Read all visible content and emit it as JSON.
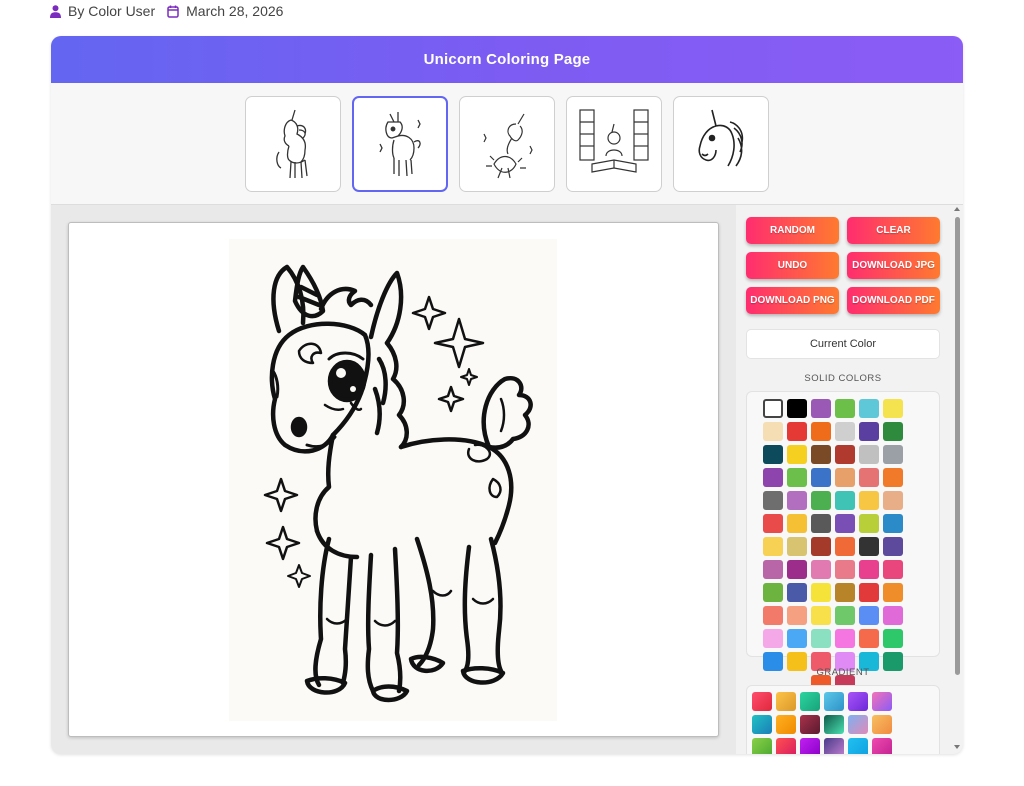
{
  "meta": {
    "author": "By Color User",
    "date": "March 28, 2026"
  },
  "header": {
    "title": "Unicorn Coloring Page"
  },
  "thumbnails": [
    {
      "name": "standing-unicorn",
      "active": false
    },
    {
      "name": "baby-unicorn",
      "active": true
    },
    {
      "name": "unicorn-with-flowers",
      "active": false
    },
    {
      "name": "unicorn-library",
      "active": false
    },
    {
      "name": "unicorn-head",
      "active": false
    }
  ],
  "buttons": {
    "random": "RANDOM",
    "clear": "CLEAR",
    "undo": "UNDO",
    "download_jpg": "DOWNLOAD JPG",
    "download_png": "DOWNLOAD PNG",
    "download_pdf": "DOWNLOAD PDF"
  },
  "current_color": {
    "label": "Current Color"
  },
  "solid": {
    "title": "SOLID COLORS",
    "colors": [
      "#ffffff",
      "#000000",
      "#9b59b6",
      "#6cc04a",
      "#5fc8d8",
      "#f4e34f",
      "#f5deb3",
      "#e53935",
      "#ef6c1a",
      "#cfcfcf",
      "#5b3fa0",
      "#2e8b3e",
      "#0d4a5c",
      "#f5d020",
      "#7a4a26",
      "#b03a2e",
      "#c0c0c0",
      "#9aa0a6",
      "#8e44ad",
      "#6cbf4a",
      "#3b73c9",
      "#e8a06b",
      "#e57373",
      "#f07a2a",
      "#6e6e6e",
      "#b36fbf",
      "#4caf50",
      "#3ec3b5",
      "#f7c642",
      "#e8ae88",
      "#e94a4a",
      "#f5c033",
      "#595959",
      "#7a4fb5",
      "#b8cf3a",
      "#2a8bc8",
      "#f7d154",
      "#d8c370",
      "#a33a2a",
      "#f06a38",
      "#333333",
      "#5e4a9c",
      "#b866a8",
      "#9c2d8a",
      "#e07ab0",
      "#e87a8a",
      "#e8408e",
      "#e8467c",
      "#6db33f",
      "#4a5aa8",
      "#f6e33a",
      "#b8842a",
      "#e23a3a",
      "#ef8d2a",
      "#f17a6a",
      "#f5a080",
      "#f7e04a",
      "#6fc86a",
      "#5a8ef5",
      "#e06ad8",
      "#f5a8e8",
      "#4aa8f5",
      "#8ae0c0",
      "#f576e0",
      "#f46a4a",
      "#2ec86a",
      "#2a8ee8",
      "#f5c01a",
      "#ef5a6a",
      "#df8af5",
      "#1ab8d8",
      "#1a9a6a",
      "#ef5a2a",
      "#c83a5a"
    ]
  },
  "gradient": {
    "title": "GRADIENT",
    "colors": [
      [
        "#ff4d6d",
        "#e0283c"
      ],
      [
        "#ffc247",
        "#d99a2a"
      ],
      [
        "#2dd4a0",
        "#17a37a"
      ],
      [
        "#5bc7e8",
        "#2e92c8"
      ],
      [
        "#a855f7",
        "#6d28d9"
      ],
      [
        "#f472b6",
        "#8b5cf6"
      ],
      [
        "#22c1c3",
        "#1a7fb8"
      ],
      [
        "#ffb020",
        "#f08a00"
      ],
      [
        "#a8324a",
        "#5a1a30"
      ],
      [
        "#0f5a4a",
        "#4ae0b0"
      ],
      [
        "#7fb0f0",
        "#e08ab8"
      ],
      [
        "#f7c060",
        "#f08a40"
      ],
      [
        "#8ad048",
        "#4aa830"
      ],
      [
        "#ff5050",
        "#d81b60"
      ],
      [
        "#c020f0",
        "#8a00c8"
      ],
      [
        "#4a3a8a",
        "#c080d0"
      ],
      [
        "#20c0f0",
        "#10a0e0"
      ],
      [
        "#f04ab0",
        "#c02090"
      ],
      [
        "#ff9a6a",
        "#f0c0a0"
      ],
      [
        "#c0a0f0",
        "#a080e8"
      ],
      [
        "#ffc0d0",
        "#f8a0b8"
      ]
    ]
  }
}
